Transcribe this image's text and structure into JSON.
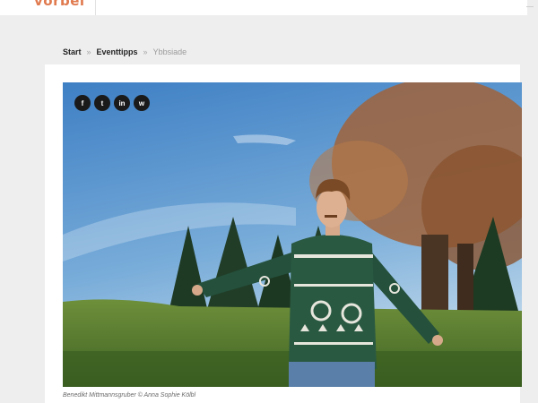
{
  "header": {
    "logo_text": "vorbei",
    "logo_color": "#e07a4f"
  },
  "breadcrumb": {
    "items": [
      "Start",
      "Eventtipps",
      "Ybbsiade"
    ],
    "separator": "»"
  },
  "share": {
    "buttons": [
      {
        "icon": "facebook-icon",
        "glyph": "f"
      },
      {
        "icon": "twitter-icon",
        "glyph": "t"
      },
      {
        "icon": "linkedin-icon",
        "glyph": "in"
      },
      {
        "icon": "whatsapp-icon",
        "glyph": "w"
      }
    ]
  },
  "image": {
    "caption": "Benedikt Mittmannsgruber © Anna Sophie Kölbl"
  }
}
